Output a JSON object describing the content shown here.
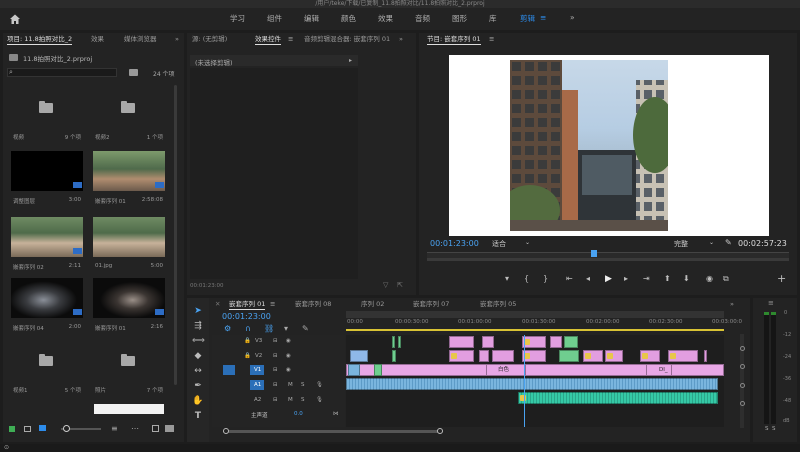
{
  "titlebar": {
    "path": "/用户/teke/下载/已复制_11.8拍照对比/11.8拍照对比_2.prproj"
  },
  "workspaces": [
    {
      "label": "学习"
    },
    {
      "label": "组件"
    },
    {
      "label": "编辑"
    },
    {
      "label": "颜色"
    },
    {
      "label": "效果"
    },
    {
      "label": "音频"
    },
    {
      "label": "图形"
    },
    {
      "label": "库"
    },
    {
      "label": "剪辑"
    }
  ],
  "project": {
    "tabs": [
      {
        "label": "项目: 11.8拍照对比_2"
      },
      {
        "label": "效果"
      },
      {
        "label": "媒体浏览器"
      }
    ],
    "file_name": "11.8拍照对比_2.prproj",
    "item_count": "24 个项",
    "items": [
      {
        "name": "视频",
        "meta": "9 个项"
      },
      {
        "name": "视频2",
        "meta": "1 个项"
      },
      {
        "name": "调整图层",
        "meta": "3:00"
      },
      {
        "name": "嵌套序列 01",
        "meta": "2:58:08"
      },
      {
        "name": "嵌套序列 02",
        "meta": "2:11"
      },
      {
        "name": "01.jpg",
        "meta": "5:00"
      },
      {
        "name": "嵌套序列 04",
        "meta": "2:00"
      },
      {
        "name": "嵌套序列 01",
        "meta": "2:16"
      },
      {
        "name": "视频1",
        "meta": "5 个项"
      },
      {
        "name": "照片",
        "meta": "7 个项"
      }
    ]
  },
  "source": {
    "tabs": [
      {
        "label": "源: (无剪辑)"
      },
      {
        "label": "效果控件"
      },
      {
        "label": "音频剪辑混合器: 嵌套序列 01"
      }
    ],
    "no_clip": "(未选择剪辑)",
    "timecode": "00:01:23:00"
  },
  "program": {
    "title": "节目: 嵌套序列 01",
    "timecode": "00:01:23:00",
    "fit": "适合",
    "quality": "完整",
    "duration": "00:02:57:23"
  },
  "timeline": {
    "tabs": [
      {
        "label": "嵌套序列 01"
      },
      {
        "label": "嵌套序列 08"
      },
      {
        "label": "序列 02"
      },
      {
        "label": "嵌套序列 07"
      },
      {
        "label": "嵌套序列 05"
      }
    ],
    "timecode": "00:01:23:00",
    "ruler": [
      "00:00",
      "00:00:30:00",
      "00:01:00:00",
      "00:01:30:00",
      "00:02:00:00",
      "00:02:30:00",
      "00:03:00:0"
    ],
    "playhead_fraction": 0.47,
    "tracks": [
      {
        "name": "V3",
        "kind": "video"
      },
      {
        "name": "V2",
        "kind": "video"
      },
      {
        "name": "V1",
        "kind": "video"
      },
      {
        "name": "A1",
        "kind": "audio"
      },
      {
        "name": "A2",
        "kind": "audio"
      }
    ],
    "master_label": "主声道",
    "master_value": "0.0",
    "clip_label_white": "白色",
    "clip_label_di": "DI_"
  },
  "meter": {
    "scale": [
      "0",
      "-12",
      "-24",
      "-36",
      "-48",
      "dB"
    ],
    "solo": [
      "S",
      "S"
    ]
  },
  "colors": {
    "accent": "#2d8ceb",
    "pink": "#e29ee0",
    "green": "#6fce8f",
    "audio": "#7ab5de",
    "teal": "#35c9a6"
  }
}
